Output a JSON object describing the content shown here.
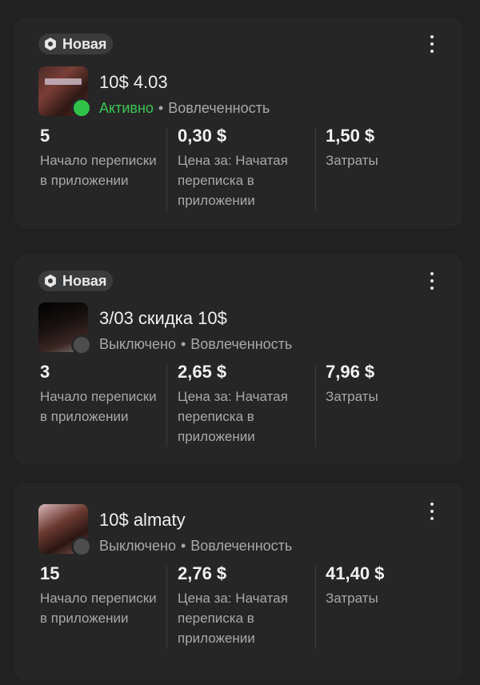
{
  "campaigns": [
    {
      "badge": "Новая",
      "title": "10$ 4.03",
      "status": "Активно",
      "status_active": true,
      "separator": "•",
      "objective": "Вовлеченность",
      "metrics": [
        {
          "value": "5",
          "label": "Начало переписки в приложении"
        },
        {
          "value": "0,30 $",
          "label": "Цена за: Начатая переписка в приложении"
        },
        {
          "value": "1,50 $",
          "label": "Затраты"
        }
      ]
    },
    {
      "badge": "Новая",
      "title": "3/03 скидка 10$",
      "status": "Выключено",
      "status_active": false,
      "separator": "•",
      "objective": "Вовлеченность",
      "metrics": [
        {
          "value": "3",
          "label": "Начало переписки в приложении"
        },
        {
          "value": "2,65 $",
          "label": "Цена за: Начатая переписка в приложении"
        },
        {
          "value": "7,96 $",
          "label": "Затраты"
        }
      ]
    },
    {
      "title": "10$ almaty",
      "status": "Выключено",
      "status_active": false,
      "separator": "•",
      "objective": "Вовлеченность",
      "metrics": [
        {
          "value": "15",
          "label": "Начало переписки в приложении"
        },
        {
          "value": "2,76 $",
          "label": "Цена за: Начатая переписка в приложении"
        },
        {
          "value": "41,40 $",
          "label": "Затраты"
        }
      ]
    }
  ],
  "colors": {
    "background": "#212121",
    "card": "#262626",
    "active": "#31c24a",
    "inactive": "#4d4d4d",
    "muted_text": "#a8a8a8"
  },
  "icons": {
    "badge": "gear-icon",
    "menu": "more-vertical-icon"
  }
}
